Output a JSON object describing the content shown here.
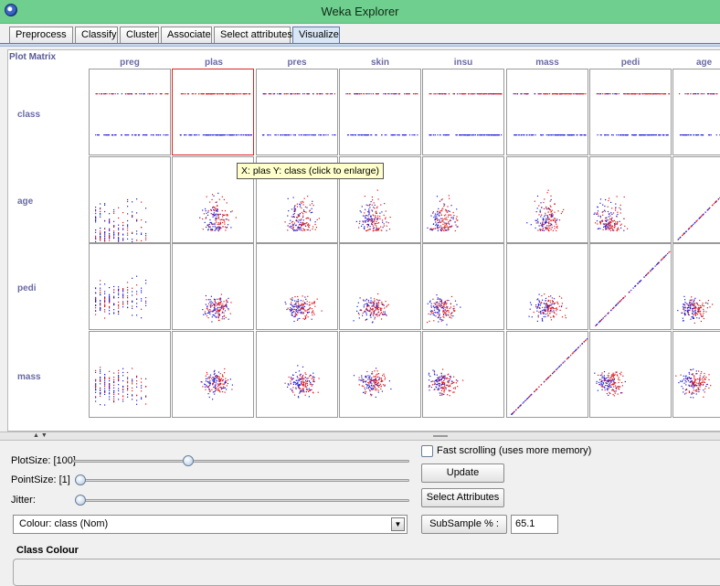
{
  "window": {
    "title": "Weka Explorer",
    "icon": "weka-bird-icon"
  },
  "tabs": [
    {
      "label": "Preprocess",
      "active": false
    },
    {
      "label": "Classify",
      "active": false
    },
    {
      "label": "Cluster",
      "active": false
    },
    {
      "label": "Associate",
      "active": false
    },
    {
      "label": "Select attributes",
      "active": false
    },
    {
      "label": "Visualize",
      "active": true
    }
  ],
  "matrix": {
    "label": "Plot Matrix",
    "columns": [
      "preg",
      "plas",
      "pres",
      "skin",
      "insu",
      "mass",
      "pedi",
      "age"
    ],
    "rows": [
      "class",
      "age",
      "pedi",
      "mass"
    ],
    "selected_cell": {
      "x": "plas",
      "y": "class"
    },
    "tooltip": "X: plas Y: class (click to enlarge)",
    "class_colors": {
      "tested_negative": "#1f1fd6",
      "tested_positive": "#e01818"
    }
  },
  "controls": {
    "plot_size": {
      "label": "PlotSize: [100]",
      "value": 100
    },
    "point_size": {
      "label": "PointSize: [1]",
      "value": 1
    },
    "jitter": {
      "label": "Jitter:",
      "value": 0
    },
    "colour": {
      "label": "Colour: class  (Nom)"
    },
    "fast_scrolling": {
      "label": "Fast scrolling (uses more memory)",
      "checked": false
    },
    "update_button": "Update",
    "select_attributes_button": "Select Attributes",
    "subsample_button": "SubSample % :",
    "subsample_value": "65.1",
    "class_colour_title": "Class Colour"
  }
}
